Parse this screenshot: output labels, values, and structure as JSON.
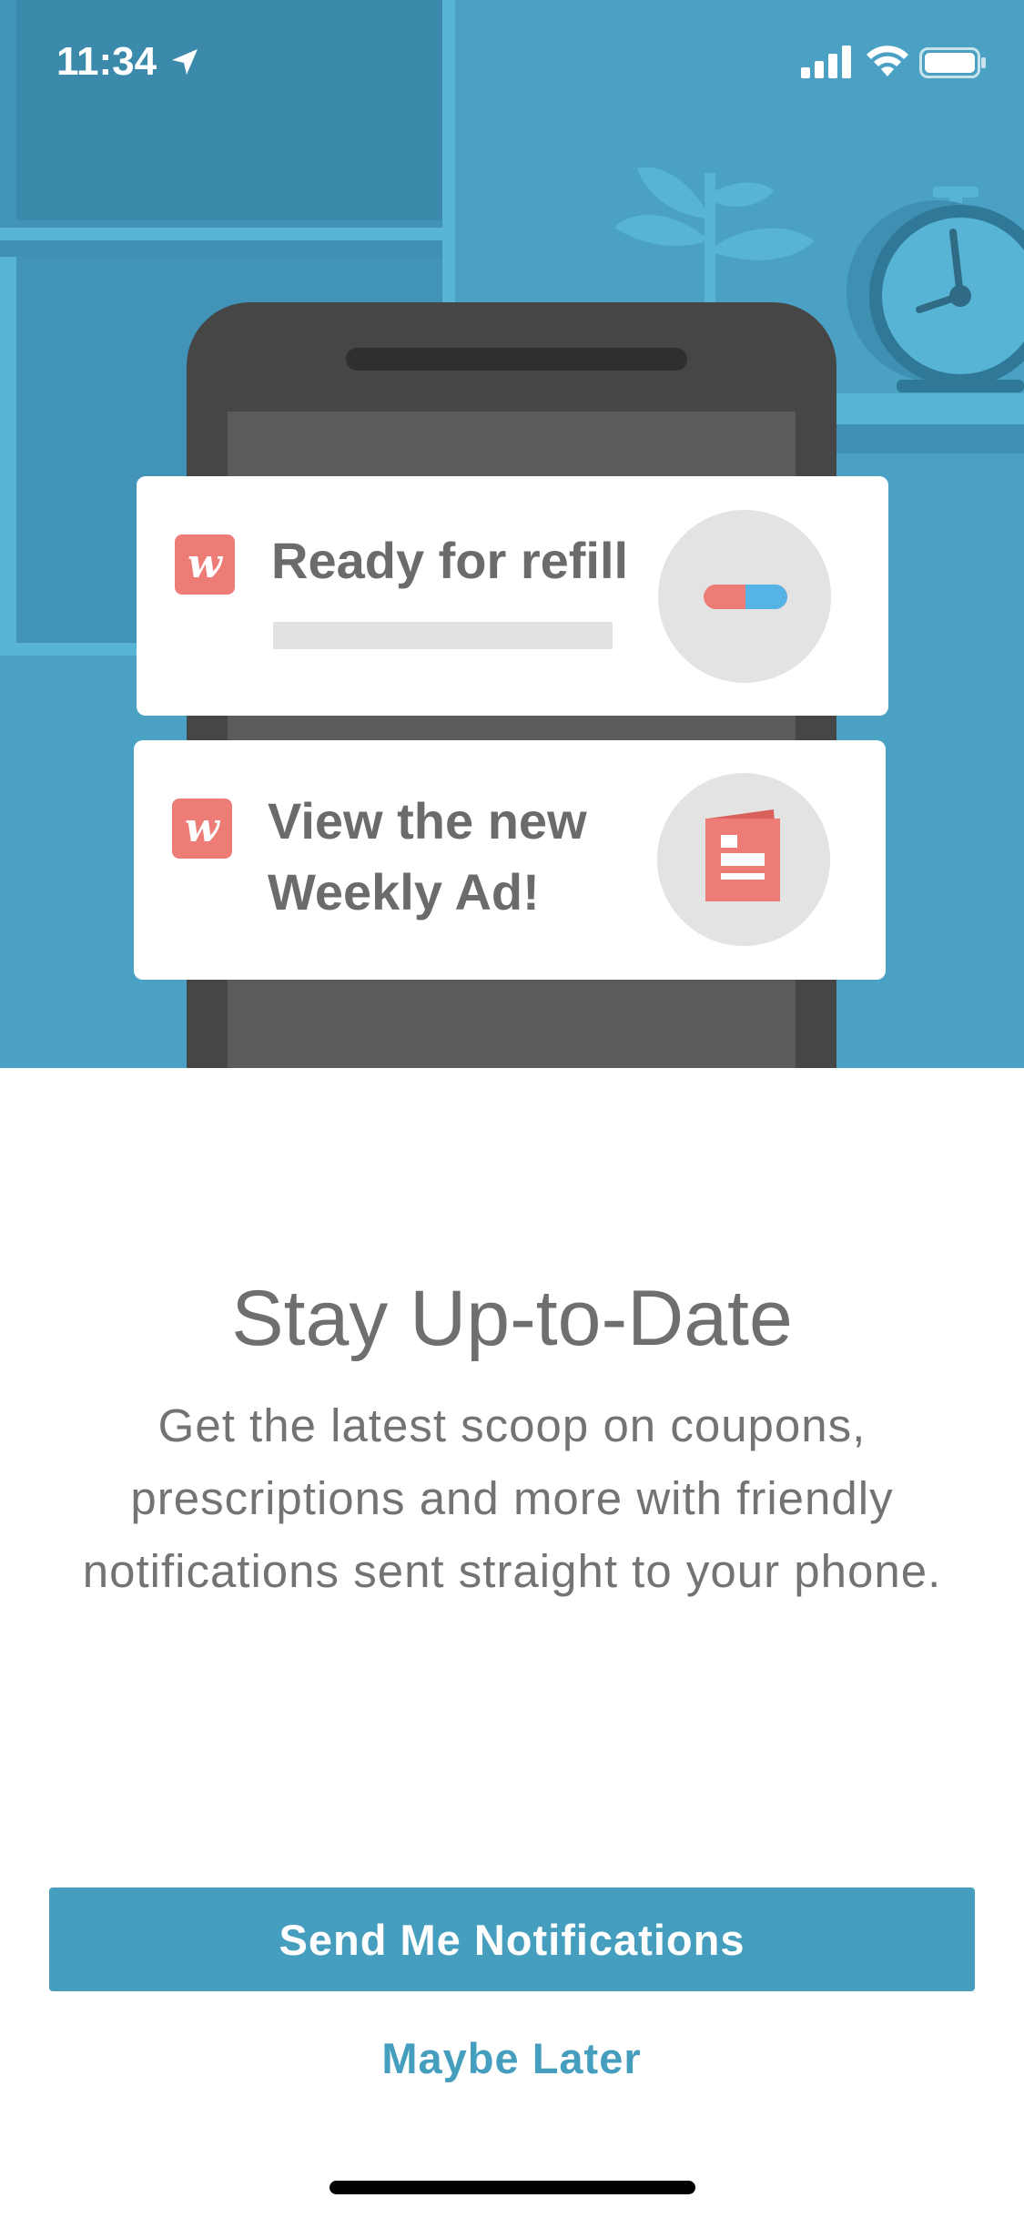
{
  "status_bar": {
    "time": "11:34",
    "location_icon": "location-arrow-icon",
    "signal_icon": "cellular-signal-icon",
    "wifi_icon": "wifi-icon",
    "battery_icon": "battery-icon"
  },
  "illustration": {
    "notifications": [
      {
        "app_icon": "walgreens-w-icon",
        "badge_glyph": "w",
        "title": "Ready for refill",
        "graphic_icon": "pill-capsule-icon"
      },
      {
        "app_icon": "walgreens-w-icon",
        "badge_glyph": "w",
        "title": "View the new Weekly Ad!",
        "graphic_icon": "weekly-ad-booklet-icon"
      }
    ]
  },
  "content": {
    "headline": "Stay Up-to-Date",
    "body": "Get the latest scoop on coupons, prescriptions and more with friendly notifications sent straight to your phone."
  },
  "actions": {
    "primary_label": "Send Me Notifications",
    "secondary_label": "Maybe Later"
  },
  "colors": {
    "hero_background": "#4aa1c4",
    "accent": "#459ebd",
    "brand_red": "#ed7b76",
    "text_gray": "#6f6f6f"
  }
}
